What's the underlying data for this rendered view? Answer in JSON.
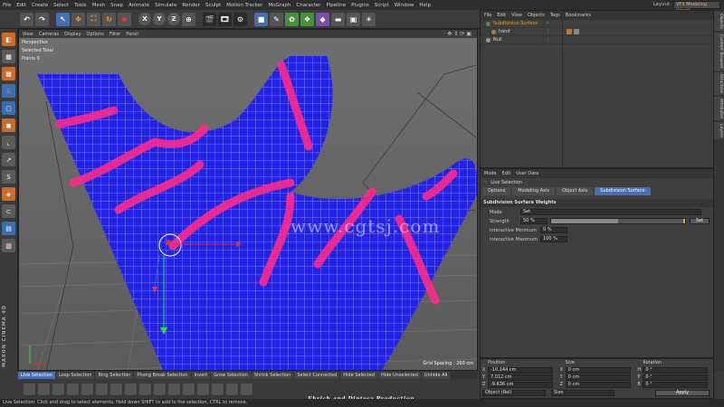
{
  "menubar": {
    "items": [
      "File",
      "Edit",
      "Create",
      "Select",
      "Tools",
      "Mesh",
      "Snap",
      "Animate",
      "Simulate",
      "Render",
      "Sculpt",
      "Motion Tracker",
      "MoGraph",
      "Character",
      "Pipeline",
      "Plugins",
      "Script",
      "Window",
      "Help"
    ],
    "layout_label": "Layout:",
    "layout_value": "VFX Modeling (User)"
  },
  "toolbar": {
    "x": "X",
    "y": "Y",
    "z": "Z"
  },
  "viewport": {
    "menu": [
      "View",
      "Cameras",
      "Display",
      "Options",
      "Filter",
      "Panel"
    ],
    "camera_label": "Perspective",
    "info_selected": "Selected Total",
    "info_points": "Points  0",
    "grid_spacing": "Grid Spacing : 200 cm",
    "watermark": "www.cgtsj.com"
  },
  "left_logo": "MAXON CINEMA 4D",
  "objects": {
    "menu": [
      "File",
      "Edit",
      "View",
      "Objects",
      "Tags",
      "Bookmarks"
    ],
    "rows": [
      {
        "name": "Subdivision Surface",
        "selected": true
      },
      {
        "name": "hand",
        "selected": false
      },
      {
        "name": "Null",
        "selected": false
      }
    ]
  },
  "attributes": {
    "menu": [
      "Mode",
      "Edit",
      "User Data"
    ],
    "title": "Live Selection",
    "tabs": [
      "Options",
      "Modeling Axis",
      "Object Axis",
      "Subdivision Surface"
    ],
    "section": "Subdivision Surface Weights",
    "mode_label": "Mode",
    "mode_value": "Set",
    "strength_label": "Strength",
    "strength_value": "50 %",
    "strength_fraction": 0.5,
    "set_button": "Set",
    "imin_label": "Interactive Minimum",
    "imin_value": "0 %",
    "imax_label": "Interactive Maximum",
    "imax_value": "100 %"
  },
  "right_tabs": [
    "Objects",
    "Content Browser",
    "Structure",
    "Attributes",
    "Layers"
  ],
  "coordinates": {
    "headers": [
      "Position",
      "Size",
      "Rotation"
    ],
    "rows": [
      {
        "p_axis": "X",
        "p": "-10.144 cm",
        "s_axis": "X",
        "s": "0 cm",
        "r_axis": "H",
        "r": "0 °"
      },
      {
        "p_axis": "Y",
        "p": "7.012 cm",
        "s_axis": "Y",
        "s": "0 cm",
        "r_axis": "P",
        "r": "0 °"
      },
      {
        "p_axis": "Z",
        "p": "-9.636 cm",
        "s_axis": "Z",
        "s": "0 cm",
        "r_axis": "B",
        "r": "0 °"
      }
    ],
    "object_mode": "Object (Rel)",
    "size_mode": "Size",
    "apply": "Apply"
  },
  "bottom_tabs": [
    "Live Selection",
    "Loop Selection",
    "Ring Selection",
    "Phong Break Selection",
    "Invert",
    "Grow Selection",
    "Shrink Selection",
    "Select Connected",
    "Hide Selected",
    "Hide Unselected",
    "Unhide All"
  ],
  "credit": "Ehrich   and   Diptesz  Production",
  "status": "Live Selection: Click and drag to select elements. Hold down SHIFT to add to the selection, CTRL to remove."
}
